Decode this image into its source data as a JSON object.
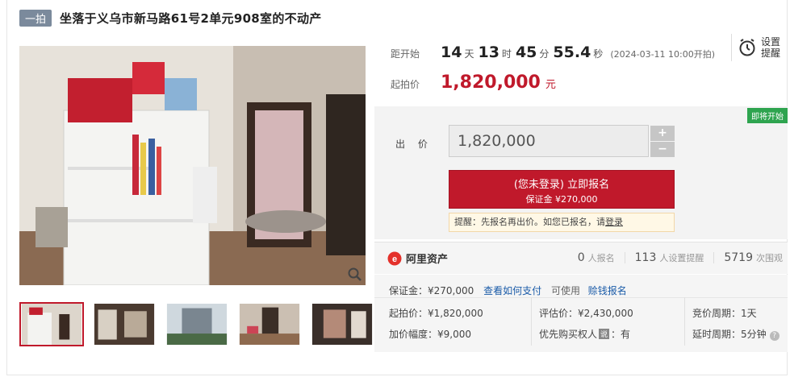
{
  "header": {
    "tag": "一拍",
    "title": "坐落于义乌市新马路61号2单元908室的不动产"
  },
  "countdown": {
    "label": "距开始",
    "days": "14",
    "days_unit": "天",
    "hours": "13",
    "hours_unit": "时",
    "minutes": "45",
    "minutes_unit": "分",
    "seconds": "55.4",
    "seconds_unit": "秒",
    "start_note": "(2024-03-11 10:00开拍)"
  },
  "reminder": {
    "line1": "设置",
    "line2": "提醒"
  },
  "start_price": {
    "label": "起拍价",
    "value": "1,820,000",
    "unit": "元"
  },
  "bid": {
    "status": "即将开始",
    "label": "出 价",
    "input_value": "1,820,000",
    "plus": "+",
    "minus": "−",
    "signup_line1": "(您未登录) 立即报名",
    "signup_line2": "保证金 ¥270,000",
    "tip_prefix": "提醒：先报名再出价。如您已报名，请",
    "tip_link": "登录"
  },
  "platform": {
    "name": "阿里资产",
    "signups": "0",
    "signups_label": "人报名",
    "reminders": "113",
    "reminders_label": "人设置提醒",
    "views": "5719",
    "views_label": "次围观"
  },
  "details": {
    "deposit": "保证金：¥270,000",
    "how_to_pay": "查看如何支付",
    "usable": "可使用",
    "credit_signup": "赊钱报名",
    "start_price": "起拍价：¥1,820,000",
    "appraisal": "评估价：¥2,430,000",
    "bid_cycle": "竞价周期：1天",
    "increment": "加价幅度：¥9,000",
    "priority_prefix": "优先购买权人",
    "priority_badge": "说",
    "priority_suffix": "：有",
    "extension": "延时周期：5分钟",
    "help": "?"
  },
  "colors": {
    "accent": "#c0192b",
    "badge_green": "#2ea44f",
    "link": "#1a5ba8"
  }
}
